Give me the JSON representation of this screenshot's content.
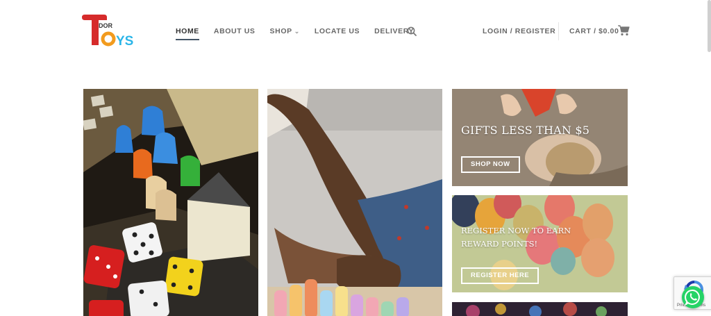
{
  "brand": {
    "logo_letters_top": "DOR",
    "logo_letters_main": "YS",
    "colors": {
      "red": "#d62b2b",
      "orange": "#f29b1e",
      "blue": "#2bb5e8",
      "green": "#4ab848",
      "nav_active_underline": "#445566"
    }
  },
  "nav": {
    "items": [
      {
        "label": "HOME",
        "active": true
      },
      {
        "label": "ABOUT US",
        "active": false
      },
      {
        "label": "SHOP",
        "active": false,
        "has_dropdown": true
      },
      {
        "label": "LOCATE US",
        "active": false
      },
      {
        "label": "DELIVERY",
        "active": false
      }
    ],
    "search_icon": "search-icon"
  },
  "account": {
    "login_label": "LOGIN / REGISTER"
  },
  "cart": {
    "label": "CART / $0.00",
    "icon": "cart-icon"
  },
  "tiles": {
    "gifts": {
      "title": "GIFTS LESS THAN $5",
      "button": "SHOP NOW"
    },
    "register": {
      "title": "REGISTER NOW TO EARN REWARD POINTS!",
      "button": "REGISTER HERE"
    }
  },
  "floating": {
    "whatsapp_icon": "whatsapp-icon",
    "recaptcha_icon": "recaptcha-icon",
    "recaptcha_text": "Privacy - Terms"
  }
}
